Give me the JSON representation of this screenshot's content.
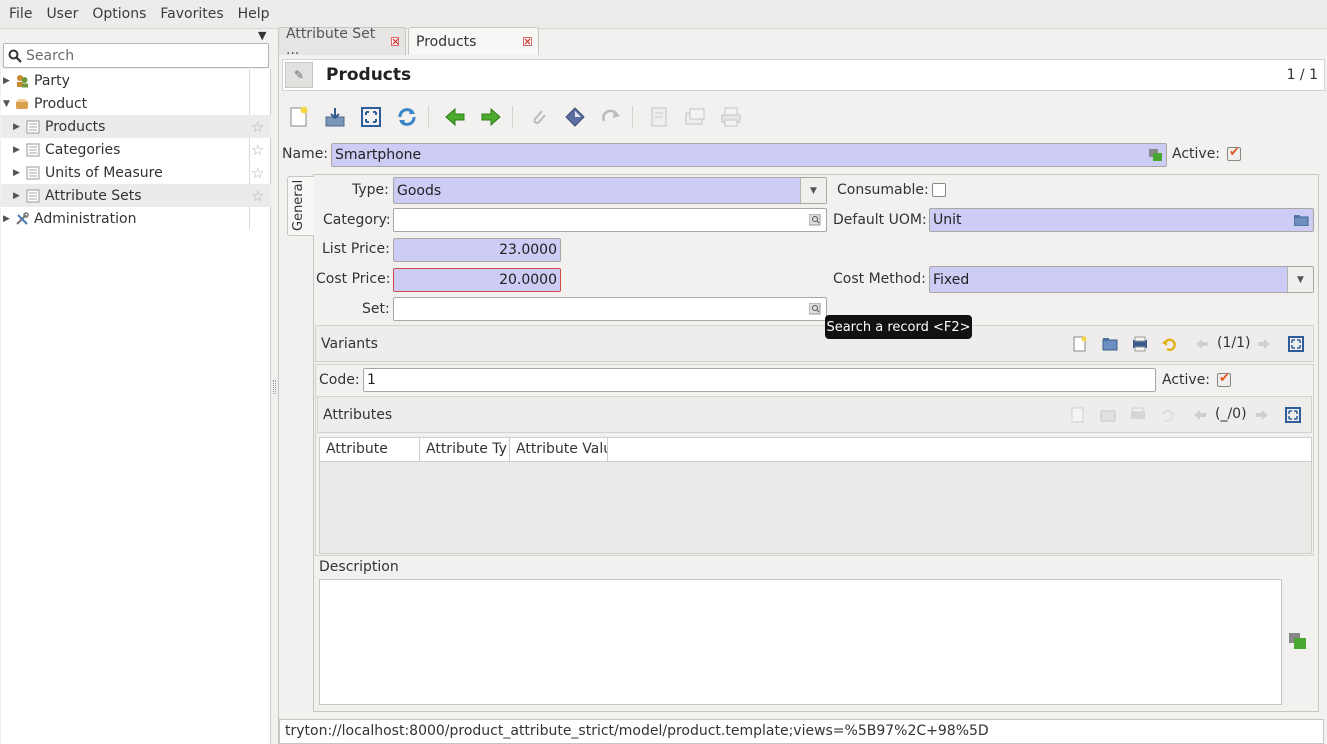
{
  "menubar": {
    "items": [
      "File",
      "User",
      "Options",
      "Favorites",
      "Help"
    ]
  },
  "sidebar": {
    "search_placeholder": "Search",
    "items": [
      {
        "label": "Party",
        "icon": "party-icon"
      },
      {
        "label": "Product",
        "icon": "product-icon"
      },
      {
        "label": "Products",
        "icon": "list-icon"
      },
      {
        "label": "Categories",
        "icon": "list-icon"
      },
      {
        "label": "Units of Measure",
        "icon": "list-icon"
      },
      {
        "label": "Attribute Sets",
        "icon": "list-icon"
      },
      {
        "label": "Administration",
        "icon": "admin-icon"
      }
    ]
  },
  "tabs": [
    {
      "label": "Attribute Set ..."
    },
    {
      "label": "Products"
    }
  ],
  "form": {
    "title": "Products",
    "record_count": "1 / 1",
    "name_label": "Name:",
    "name_value": "Smartphone",
    "active_label": "Active:",
    "notebook_tab": "General",
    "type_label": "Type:",
    "type_value": "Goods",
    "consumable_label": "Consumable:",
    "category_label": "Category:",
    "category_value": "",
    "default_uom_label": "Default UOM:",
    "default_uom_value": "Unit",
    "list_price_label": "List Price:",
    "list_price_value": "23.0000",
    "cost_price_label": "Cost Price:",
    "cost_price_value": "20.0000",
    "cost_method_label": "Cost Method:",
    "cost_method_value": "Fixed",
    "set_label": "Set:",
    "set_value": "",
    "tooltip": "Search a record <F2>",
    "variants": {
      "title": "Variants",
      "pager": "(1/1)",
      "code_label": "Code:",
      "code_value": "1",
      "active_label": "Active:"
    },
    "attributes": {
      "title": "Attributes",
      "pager": "(_/0)",
      "columns": [
        "Attribute",
        "Attribute Ty",
        "Attribute Valu"
      ]
    },
    "description_label": "Description",
    "description_value": ""
  },
  "statusbar": {
    "url": "tryton://localhost:8000/product_attribute_strict/model/product.template;views=%5B97%2C+98%5D"
  },
  "colors": {
    "required_field": "#ccccf5",
    "error_border": "#d14b4b",
    "checkbox_mark": "#e2571e"
  }
}
